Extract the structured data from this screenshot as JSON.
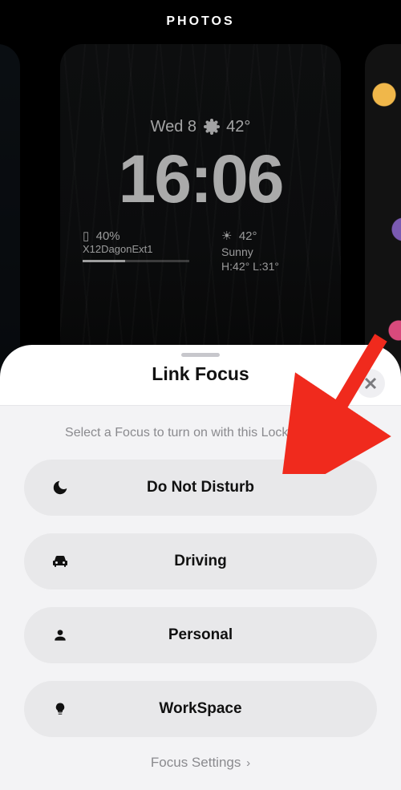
{
  "top": {
    "label": "PHOTOS"
  },
  "lockscreen": {
    "dateline": {
      "day": "Wed 8",
      "temp": "42°"
    },
    "clock": "16:06",
    "battery": {
      "pct": "40%",
      "network": "X12DagonExt1"
    },
    "weather": {
      "temp": "42°",
      "cond": "Sunny",
      "hilo": "H:42° L:31°"
    }
  },
  "sheet": {
    "title": "Link Focus",
    "sub": "Select a Focus to turn on with this Lock Screen.",
    "items": [
      {
        "label": "Do Not Disturb"
      },
      {
        "label": "Driving"
      },
      {
        "label": "Personal"
      },
      {
        "label": "WorkSpace"
      }
    ],
    "settings": "Focus Settings"
  }
}
